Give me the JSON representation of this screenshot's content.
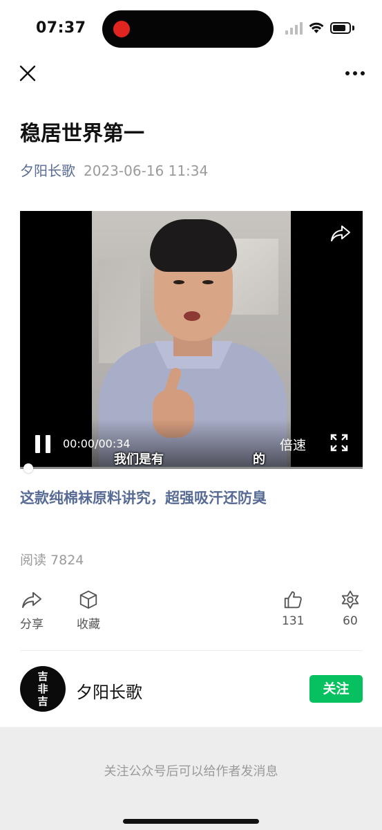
{
  "status_bar": {
    "time": "07:37",
    "recording_color": "#e0241f"
  },
  "nav": {
    "close_icon": "close-icon",
    "more_icon": "more-icon"
  },
  "article": {
    "title": "稳居世界第一",
    "author": "夕阳长歌",
    "date": "2023-06-16 11:34"
  },
  "video": {
    "time": "00:00/00:34",
    "speed_label": "倍速",
    "subtitle_left": "我们是有",
    "subtitle_right": "的",
    "progress": 0.02
  },
  "link_text": "这款纯棉袜原料讲究，超强吸汗还防臭",
  "read_count": "阅读 7824",
  "actions": {
    "share": "分享",
    "collect": "收藏",
    "like_count": "131",
    "wow_count": "60"
  },
  "author_card": {
    "avatar_text": [
      "吉",
      "非",
      "吉"
    ],
    "name": "夕阳长歌",
    "follow_label": "关注",
    "follow_color": "#07c160"
  },
  "footer": {
    "message": "关注公众号后可以给作者发消息"
  },
  "colors": {
    "link": "#576b95",
    "muted": "#9a9a9a",
    "footer_bg": "#ededed"
  }
}
